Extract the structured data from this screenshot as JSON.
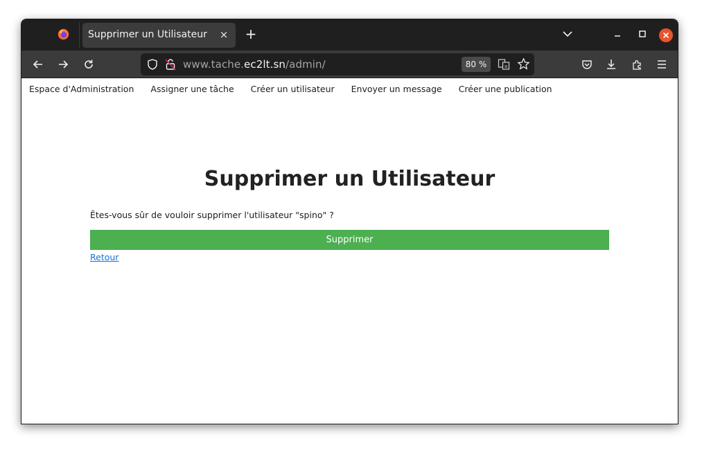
{
  "browser": {
    "tab_title": "Supprimer un Utilisateur",
    "tab_close_glyph": "×",
    "new_tab_glyph": "+",
    "url_prefix": "www.tache.",
    "url_domain": "ec2lt.sn",
    "url_path": "/admin/",
    "zoom": "80 %"
  },
  "nav": {
    "items": [
      "Espace d'Administration",
      "Assigner une tâche",
      "Créer un utilisateur",
      "Envoyer un message",
      "Créer une publication"
    ]
  },
  "page": {
    "title": "Supprimer un Utilisateur",
    "confirm_text": "Êtes-vous sûr de vouloir supprimer l'utilisateur \"spino\" ?",
    "delete_label": "Supprimer",
    "back_label": "Retour"
  },
  "colors": {
    "button_green": "#4caf50",
    "link_blue": "#1a6fd6",
    "close_orange": "#e9542b"
  }
}
